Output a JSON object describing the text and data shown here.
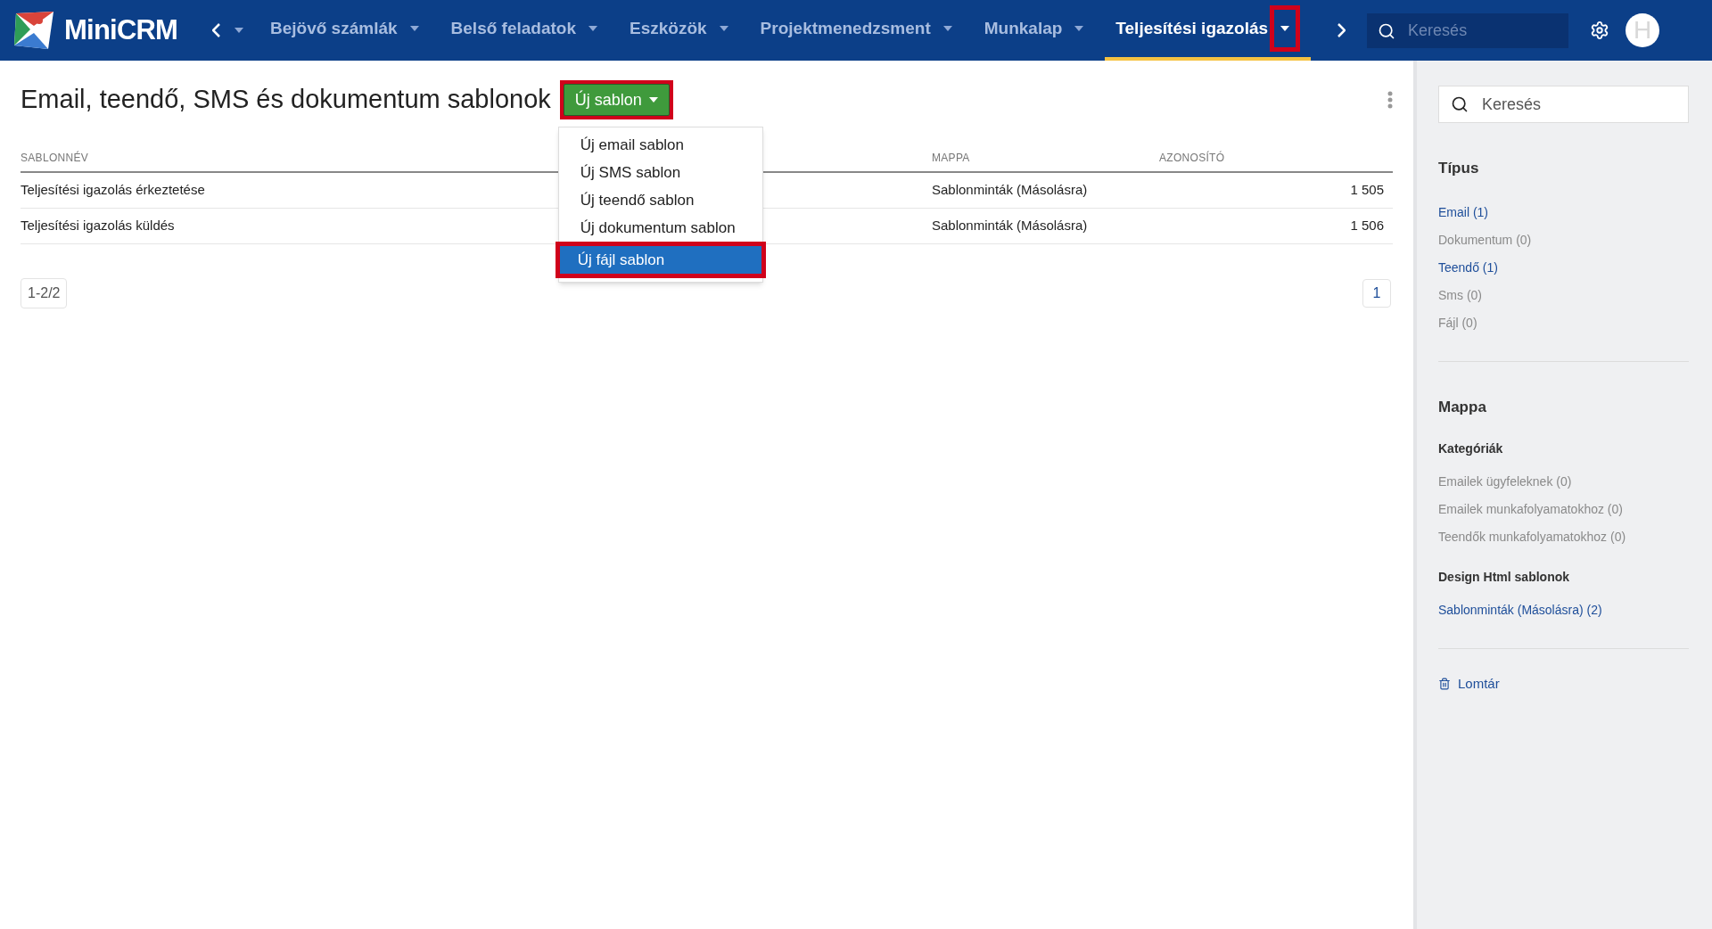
{
  "header": {
    "logo": "MiniCRM",
    "nav": [
      {
        "label": "Bejövő számlák",
        "selected": false,
        "highlighted": false
      },
      {
        "label": "Belső feladatok",
        "selected": false,
        "highlighted": false
      },
      {
        "label": "Eszközök",
        "selected": false,
        "highlighted": false
      },
      {
        "label": "Projektmenedzsment",
        "selected": false,
        "highlighted": false
      },
      {
        "label": "Munkalap",
        "selected": false,
        "highlighted": false
      },
      {
        "label": "Teljesítési igazolás",
        "selected": true,
        "highlighted": true
      }
    ],
    "search": {
      "placeholder": "Keresés"
    },
    "avatar": "H"
  },
  "page": {
    "title": "Email, teendő, SMS és dokumentum sablonok",
    "new_button": {
      "label": "Új sablon",
      "highlighted": true
    },
    "menu": [
      {
        "label": "Új email sablon",
        "selected": false,
        "highlighted": false
      },
      {
        "label": "Új SMS sablon",
        "selected": false,
        "highlighted": false
      },
      {
        "label": "Új teendő sablon",
        "selected": false,
        "highlighted": false
      },
      {
        "label": "Új dokumentum sablon",
        "selected": false,
        "highlighted": false
      },
      {
        "label": "Új fájl sablon",
        "selected": true,
        "highlighted": true
      }
    ],
    "table": {
      "columns": [
        "SABLONNÉV",
        "MAPPA",
        "AZONOSÍTÓ"
      ],
      "rows": [
        [
          "Teljesítési igazolás érkeztetése",
          "Sablonminták (Másolásra)",
          "1 505"
        ],
        [
          "Teljesítési igazolás küldés",
          "Sablonminták (Másolásra)",
          "1 506"
        ]
      ]
    },
    "range": "1-2/2",
    "pages": [
      {
        "label": "1",
        "selected": true
      }
    ]
  },
  "sidebar": {
    "search": {
      "placeholder": "Keresés"
    },
    "type_title": "Típus",
    "types": [
      {
        "label": "Email (1)",
        "active": true
      },
      {
        "label": "Dokumentum (0)",
        "active": false
      },
      {
        "label": "Teendő (1)",
        "active": true
      },
      {
        "label": "Sms (0)",
        "active": false
      },
      {
        "label": "Fájl (0)",
        "active": false
      }
    ],
    "folder_title": "Mappa",
    "groups": [
      {
        "title": "Kategóriák",
        "items": [
          {
            "label": "Emailek ügyfeleknek (0)",
            "active": false
          },
          {
            "label": "Emailek munkafolyamatokhoz (0)",
            "active": false
          },
          {
            "label": "Teendők munkafolyamatokhoz (0)",
            "active": false
          }
        ]
      },
      {
        "title": "Design Html sablonok",
        "items": [
          {
            "label": "Sablonminták (Másolásra) (2)",
            "active": true
          }
        ]
      }
    ],
    "trash": "Lomtár"
  }
}
